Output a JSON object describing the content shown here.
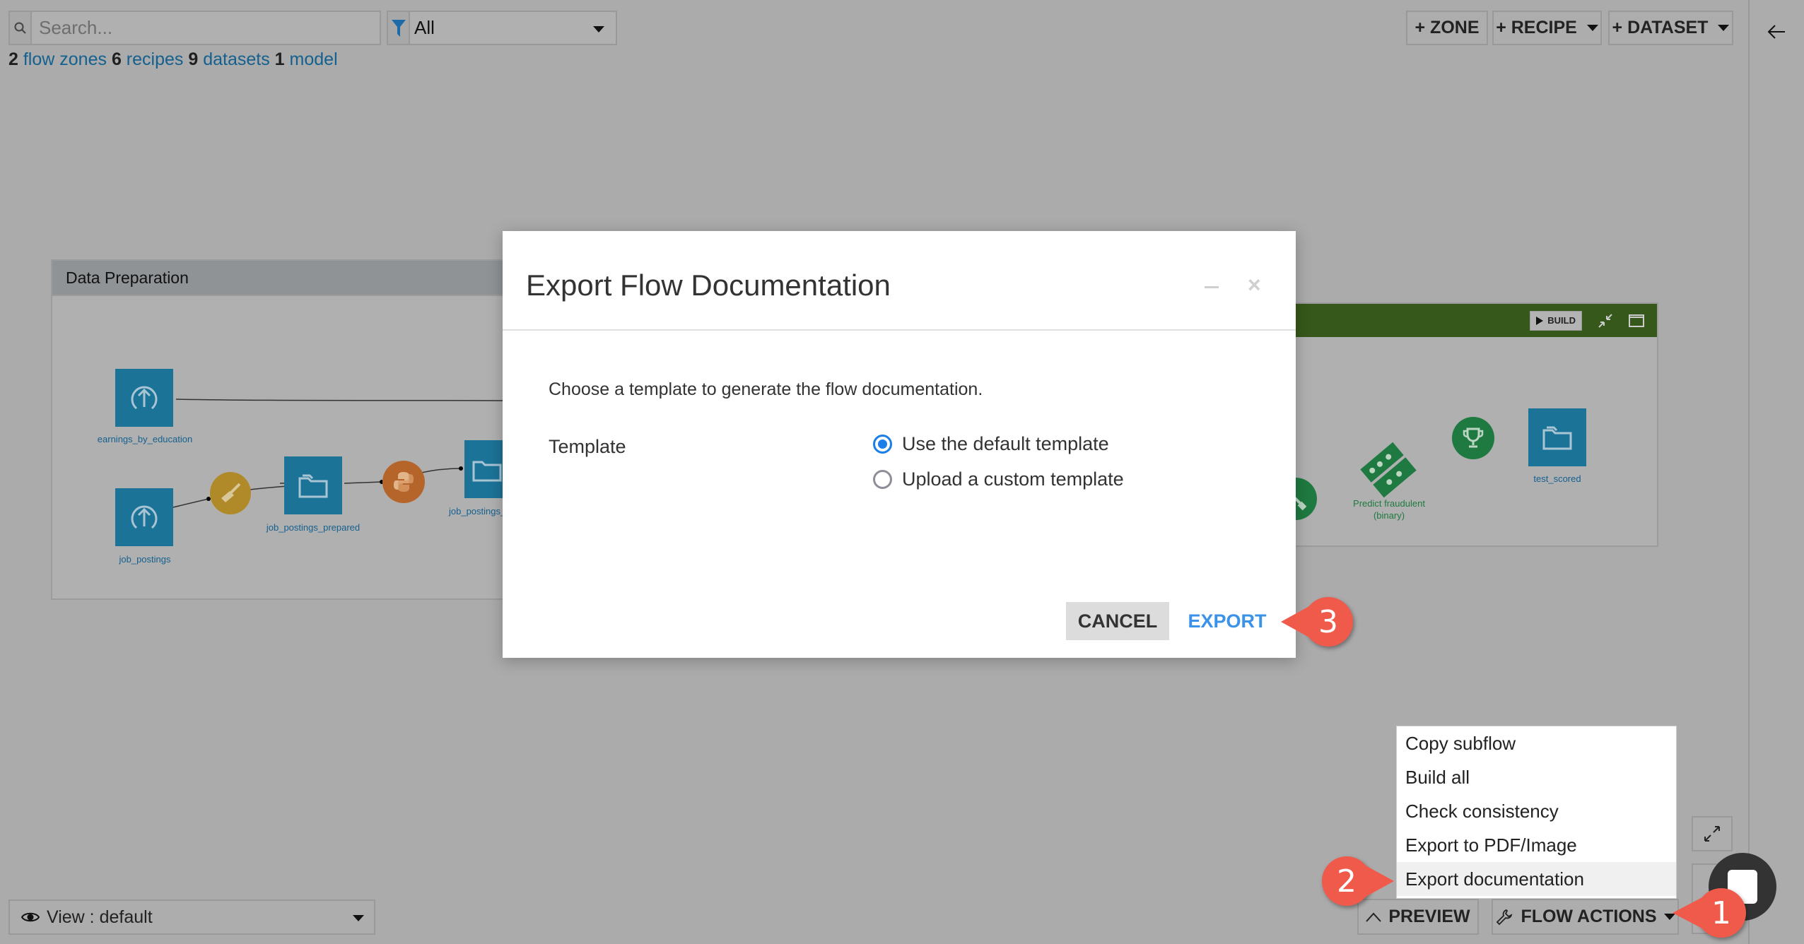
{
  "topbar": {
    "search_placeholder": "Search...",
    "search_icon": "search-icon",
    "filter_icon": "filter-icon",
    "filter_value": "All",
    "stats": [
      {
        "count": "2",
        "label": "flow zones"
      },
      {
        "count": "6",
        "label": "recipes"
      },
      {
        "count": "9",
        "label": "datasets"
      },
      {
        "count": "1",
        "label": "model"
      }
    ],
    "buttons": {
      "zone": "+ ZONE",
      "recipe": "+ RECIPE",
      "dataset": "+ DATASET"
    }
  },
  "sidebar": {
    "back_icon": "arrow-left-icon"
  },
  "zones": [
    {
      "title": "Data Preparation",
      "nodes": [
        {
          "type": "dataset",
          "icon": "upload-icon",
          "label": "earnings_by_education"
        },
        {
          "type": "dataset",
          "icon": "upload-icon",
          "label": "job_postings"
        },
        {
          "type": "recipe",
          "icon": "broom-icon",
          "label": ""
        },
        {
          "type": "dataset",
          "icon": "folder-icon",
          "label": "job_postings_prepared"
        },
        {
          "type": "recipe",
          "icon": "python-icon",
          "label": ""
        },
        {
          "type": "dataset",
          "icon": "folder-icon",
          "label": "job_postings_"
        }
      ]
    },
    {
      "title": "",
      "header_color": "#36581a",
      "build_label": "BUILD",
      "nodes": [
        {
          "type": "recipe",
          "icon": "train-icon",
          "label": ""
        },
        {
          "type": "model",
          "icon": "model-icon",
          "label": "Predict fraudulent",
          "label2": "(binary)"
        },
        {
          "type": "recipe",
          "icon": "trophy-icon",
          "label": ""
        },
        {
          "type": "dataset",
          "icon": "folder-icon",
          "label": "test_scored"
        }
      ]
    }
  ],
  "modal": {
    "title": "Export Flow Documentation",
    "description": "Choose a template to generate the flow documentation.",
    "field_label": "Template",
    "options": [
      {
        "label": "Use the default template",
        "checked": true
      },
      {
        "label": "Upload a custom template",
        "checked": false
      }
    ],
    "cancel_label": "CANCEL",
    "export_label": "EXPORT"
  },
  "dropdown": {
    "items": [
      {
        "label": "Copy subflow"
      },
      {
        "label": "Build all"
      },
      {
        "label": "Check consistency"
      },
      {
        "label": "Export to PDF/Image"
      },
      {
        "label": "Export documentation",
        "highlighted": true
      }
    ]
  },
  "bottombar": {
    "view_label": "View : default",
    "preview_label": "PREVIEW",
    "flow_actions_label": "FLOW ACTIONS"
  },
  "callouts": [
    "1",
    "2",
    "3"
  ],
  "colors": {
    "accent_blue": "#3a93e8",
    "dataset_blue": "#1c7398",
    "callout_red": "#f05a4a",
    "model_green": "#1e7a40"
  }
}
